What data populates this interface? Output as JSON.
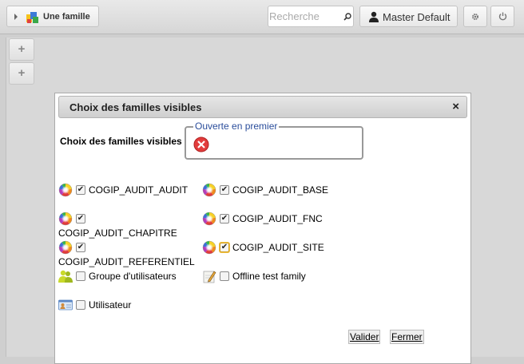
{
  "topbar": {
    "family_button_label": "Une famille",
    "search_placeholder": "Recherche",
    "user_label": "Master Default",
    "settings_icon": "gear-icon",
    "logout_icon": "power-icon"
  },
  "left_buttons": [
    "+",
    "+"
  ],
  "dialog": {
    "title": "Choix des familles visibles",
    "close_glyph": "×",
    "prompt": "Choix des familles visibles",
    "fieldset_legend": "Ouverte en premier",
    "families": [
      {
        "label": "COGIP_AUDIT_AUDIT",
        "checked": true,
        "icon": "color-wheel-icon"
      },
      {
        "label": "COGIP_AUDIT_BASE",
        "checked": true,
        "icon": "color-wheel-icon"
      },
      {
        "label": "COGIP_AUDIT_CHAPITRE",
        "checked": true,
        "icon": "color-wheel-icon"
      },
      {
        "label": "COGIP_AUDIT_FNC",
        "checked": true,
        "icon": "color-wheel-icon"
      },
      {
        "label": "COGIP_AUDIT_REFERENTIEL",
        "checked": true,
        "icon": "color-wheel-icon"
      },
      {
        "label": "COGIP_AUDIT_SITE",
        "checked": true,
        "icon": "color-wheel-icon"
      },
      {
        "label": "Groupe d'utilisateurs",
        "checked": false,
        "icon": "user-group-icon"
      },
      {
        "label": "Offline test family",
        "checked": false,
        "icon": "note-pencil-icon"
      },
      {
        "label": "Utilisateur",
        "checked": false,
        "icon": "user-card-icon"
      }
    ],
    "validate_label": "Valider",
    "close_label": "Fermer",
    "check_glyph": "✔"
  }
}
